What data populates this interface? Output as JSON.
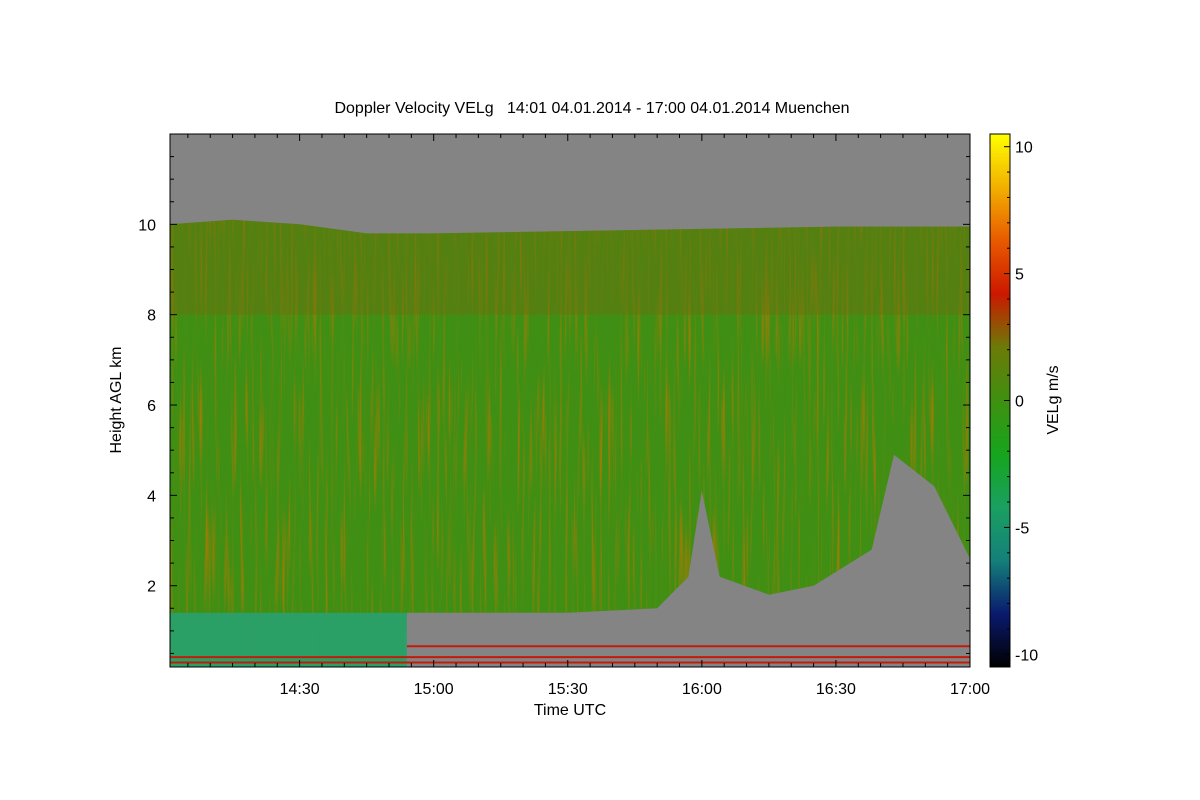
{
  "chart_data": {
    "type": "heatmap",
    "title": "Doppler Velocity VELg   14:01 04.01.2014 - 17:00 04.01.2014 Muenchen",
    "xlabel": "Time UTC",
    "ylabel": "Height AGL km",
    "colorbar_label": "VELg m/s",
    "xlim": [
      "14:01",
      "17:00"
    ],
    "ylim": [
      0.2,
      12
    ],
    "clim": [
      -10.5,
      10.5
    ],
    "x_ticks": [
      "14:30",
      "15:00",
      "15:30",
      "16:00",
      "16:30",
      "17:00"
    ],
    "y_ticks": [
      2,
      4,
      6,
      8,
      10
    ],
    "colorbar_ticks": [
      10,
      5,
      0,
      -5,
      -10
    ],
    "colormap": [
      "#000000",
      "#0a1a6e",
      "#14807a",
      "#1aa060",
      "#16a51c",
      "#3f9010",
      "#6c7a08",
      "#cc1800",
      "#e85a00",
      "#f2b000",
      "#ffff00"
    ],
    "missing_color": "#848484",
    "echo_top_km": [
      [
        "14:01",
        10.0
      ],
      [
        "14:15",
        10.1
      ],
      [
        "14:30",
        10.0
      ],
      [
        "14:45",
        9.8
      ],
      [
        "15:00",
        9.8
      ],
      [
        "15:30",
        9.85
      ],
      [
        "16:00",
        9.9
      ],
      [
        "16:30",
        9.95
      ],
      [
        "17:00",
        9.95
      ]
    ],
    "echo_base_km": [
      [
        "14:01",
        0.2
      ],
      [
        "14:53",
        0.2
      ],
      [
        "14:54",
        1.4
      ],
      [
        "15:30",
        1.4
      ],
      [
        "15:50",
        1.5
      ],
      [
        "15:57",
        2.2
      ],
      [
        "16:00",
        4.1
      ],
      [
        "16:04",
        2.2
      ],
      [
        "16:15",
        1.8
      ],
      [
        "16:25",
        2.0
      ],
      [
        "16:38",
        2.8
      ],
      [
        "16:43",
        4.9
      ],
      [
        "16:52",
        4.2
      ],
      [
        "17:00",
        2.6
      ]
    ]
  }
}
